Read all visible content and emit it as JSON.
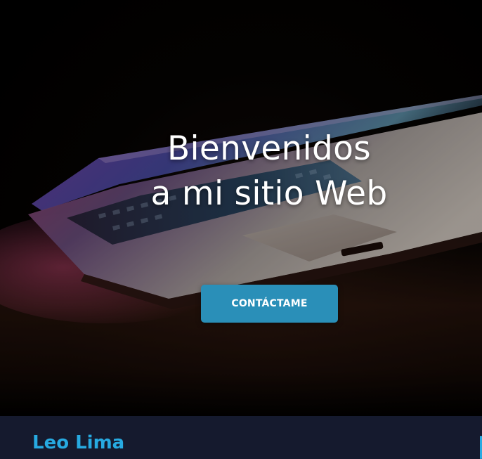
{
  "hero": {
    "title_line1": "Bienvenidos",
    "title_line2": "a mi sitio Web",
    "cta_label": "CONTÁCTAME"
  },
  "navbar": {
    "brand": "Leo Lima"
  },
  "colors": {
    "accent": "#27aae1",
    "button": "#2a8fb8",
    "navbar_bg": "#151a2e"
  }
}
